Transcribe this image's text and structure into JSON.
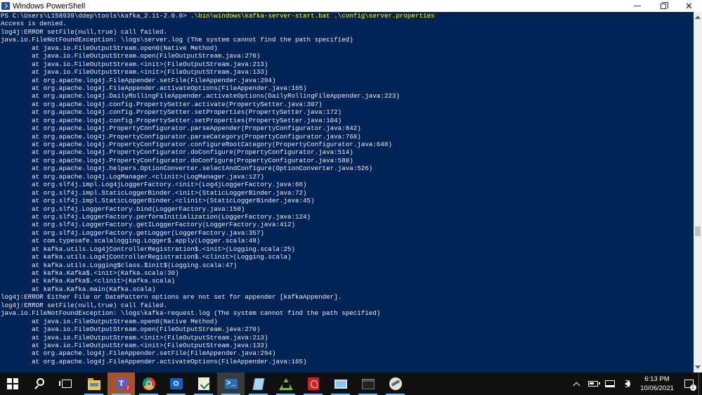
{
  "window": {
    "title": "Windows PowerShell",
    "close_glyph": "✕"
  },
  "console": {
    "prompt": "PS C:\\Users\\L158939\\ddep\\tools\\kafka_2.11-2.0.0> ",
    "command": ".\\bin\\windows\\kafka-server-start.bat .\\config\\server.properties",
    "lines": [
      "Access is denied.",
      "log4j:ERROR setFile(null,true) call failed.",
      "java.io.FileNotFoundException: \\logs\\server.log (The system cannot find the path specified)",
      "        at java.io.FileOutputStream.open0(Native Method)",
      "        at java.io.FileOutputStream.open(FileOutputStream.java:270)",
      "        at java.io.FileOutputStream.<init>(FileOutputStream.java:213)",
      "        at java.io.FileOutputStream.<init>(FileOutputStream.java:133)",
      "        at org.apache.log4j.FileAppender.setFile(FileAppender.java:294)",
      "        at org.apache.log4j.FileAppender.activateOptions(FileAppender.java:165)",
      "        at org.apache.log4j.DailyRollingFileAppender.activateOptions(DailyRollingFileAppender.java:223)",
      "        at org.apache.log4j.config.PropertySetter.activate(PropertySetter.java:307)",
      "        at org.apache.log4j.config.PropertySetter.setProperties(PropertySetter.java:172)",
      "        at org.apache.log4j.config.PropertySetter.setProperties(PropertySetter.java:104)",
      "        at org.apache.log4j.PropertyConfigurator.parseAppender(PropertyConfigurator.java:842)",
      "        at org.apache.log4j.PropertyConfigurator.parseCategory(PropertyConfigurator.java:768)",
      "        at org.apache.log4j.PropertyConfigurator.configureRootCategory(PropertyConfigurator.java:648)",
      "        at org.apache.log4j.PropertyConfigurator.doConfigure(PropertyConfigurator.java:514)",
      "        at org.apache.log4j.PropertyConfigurator.doConfigure(PropertyConfigurator.java:580)",
      "        at org.apache.log4j.helpers.OptionConverter.selectAndConfigure(OptionConverter.java:526)",
      "        at org.apache.log4j.LogManager.<clinit>(LogManager.java:127)",
      "        at org.slf4j.impl.Log4jLoggerFactory.<init>(Log4jLoggerFactory.java:66)",
      "        at org.slf4j.impl.StaticLoggerBinder.<init>(StaticLoggerBinder.java:72)",
      "        at org.slf4j.impl.StaticLoggerBinder.<clinit>(StaticLoggerBinder.java:45)",
      "        at org.slf4j.LoggerFactory.bind(LoggerFactory.java:150)",
      "        at org.slf4j.LoggerFactory.performInitialization(LoggerFactory.java:124)",
      "        at org.slf4j.LoggerFactory.getILoggerFactory(LoggerFactory.java:412)",
      "        at org.slf4j.LoggerFactory.getLogger(LoggerFactory.java:357)",
      "        at com.typesafe.scalalogging.Logger$.apply(Logger.scala:48)",
      "        at kafka.utils.Log4jControllerRegistration$.<init>(Logging.scala:25)",
      "        at kafka.utils.Log4jControllerRegistration$.<clinit>(Logging.scala)",
      "        at kafka.utils.Logging$class.$init$(Logging.scala:47)",
      "        at kafka.Kafka$.<init>(Kafka.scala:30)",
      "        at kafka.Kafka$.<clinit>(Kafka.scala)",
      "        at kafka.Kafka.main(Kafka.scala)",
      "log4j:ERROR Either File or DatePattern options are not set for appender [kafkaAppender].",
      "log4j:ERROR setFile(null,true) call failed.",
      "java.io.FileNotFoundException: \\logs\\kafka-request.log (The system cannot find the path specified)",
      "        at java.io.FileOutputStream.open0(Native Method)",
      "        at java.io.FileOutputStream.open(FileOutputStream.java:270)",
      "        at java.io.FileOutputStream.<init>(FileOutputStream.java:213)",
      "        at java.io.FileOutputStream.<init>(FileOutputStream.java:133)",
      "        at org.apache.log4j.FileAppender.setFile(FileAppender.java:294)",
      "        at org.apache.log4j.FileAppender.activateOptions(FileAppender.java:165)"
    ]
  },
  "taskbar": {
    "teams_badge": "2",
    "powershell_glyph": ">_",
    "outlook_letter": "O",
    "teams_letter": "T",
    "icons": [
      "windows-start-icon",
      "search-icon",
      "task-view-icon",
      "file-explorer-icon",
      "teams-icon",
      "chrome-icon",
      "outlook-icon",
      "sheet-app-icon",
      "powershell-icon",
      "notepad-icon",
      "vpn-icon",
      "acrobat-icon",
      "remote-desktop-icon",
      "terminal-icon",
      "bird-app-icon"
    ]
  },
  "tray": {
    "time": "6:13 PM",
    "date": "10/06/2021",
    "notification_count": "1"
  }
}
